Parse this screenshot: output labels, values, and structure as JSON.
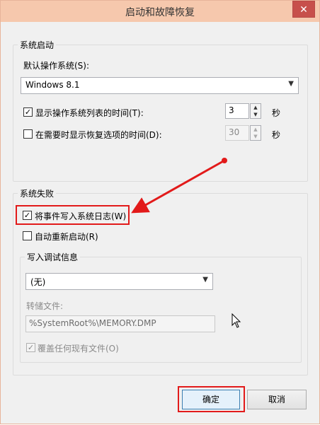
{
  "window": {
    "title": "启动和故障恢复",
    "close_glyph": "✕"
  },
  "startup": {
    "group_title": "系统启动",
    "default_os_label": "默认操作系统(S):",
    "default_os_value": "Windows 8.1",
    "show_os_list": {
      "label": "显示操作系统列表的时间(T):",
      "checked": true,
      "value": "3",
      "unit": "秒"
    },
    "show_recovery": {
      "label": "在需要时显示恢复选项的时间(D):",
      "checked": false,
      "value": "30",
      "unit": "秒"
    }
  },
  "failure": {
    "group_title": "系统失败",
    "write_event_log": {
      "label": "将事件写入系统日志(W)",
      "checked": true
    },
    "auto_restart": {
      "label": "自动重新启动(R)",
      "checked": false
    },
    "debug": {
      "group_title": "写入调试信息",
      "type_value": "(无)",
      "dump_file_label": "转储文件:",
      "dump_file_value": "%SystemRoot%\\MEMORY.DMP",
      "overwrite": {
        "label": "覆盖任何现有文件(O)",
        "checked": true
      }
    }
  },
  "buttons": {
    "ok": "确定",
    "cancel": "取消"
  },
  "annotation": {
    "highlight_color": "#e21a1a"
  },
  "colors": {
    "titlebar": "#f6c8ad",
    "close": "#c7504b",
    "dialog_bg": "#f0f0f0"
  }
}
